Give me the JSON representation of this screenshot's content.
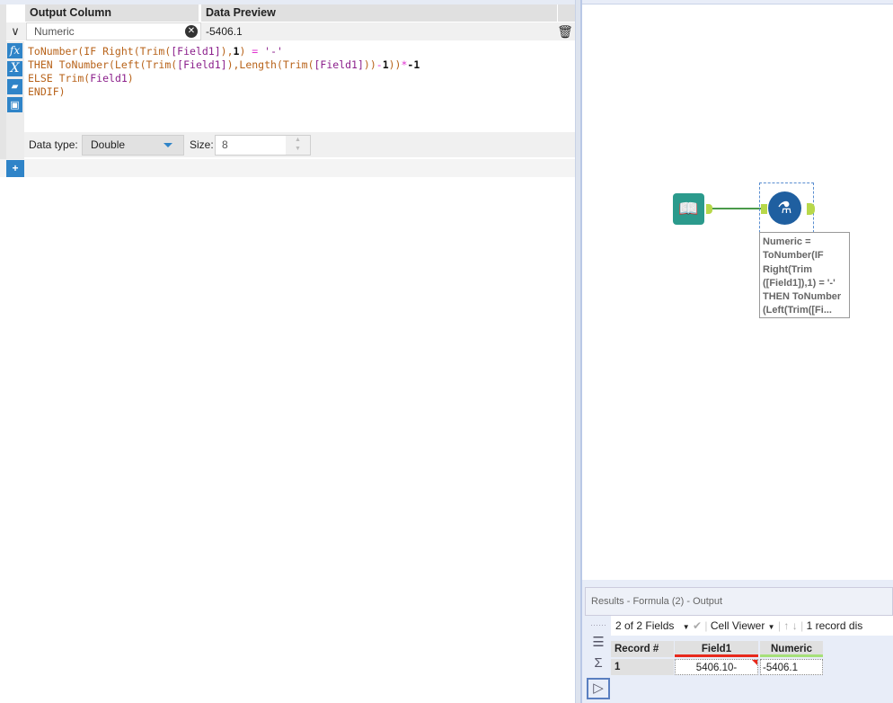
{
  "editor": {
    "headers": {
      "output_column": "Output Column",
      "data_preview": "Data Preview"
    },
    "row": {
      "name": "Numeric",
      "preview": "-5406.1"
    },
    "toolbar_icons": [
      "fx-icon",
      "variable-icon",
      "open-folder-icon",
      "save-icon"
    ],
    "formula_lines": [
      [
        [
          "ToNumber(IF Right(Trim(",
          "fn"
        ],
        [
          "[Field1]",
          "fld"
        ],
        [
          "),",
          "fn"
        ],
        [
          "1",
          "num"
        ],
        [
          ") ",
          "fn"
        ],
        [
          "= ",
          "op"
        ],
        [
          "'-'",
          "str"
        ]
      ],
      [
        [
          "THEN ToNumber(Left(Trim(",
          "fn"
        ],
        [
          "[Field1]",
          "fld"
        ],
        [
          "),Length(Trim(",
          "fn"
        ],
        [
          "[Field1]",
          "fld"
        ],
        [
          "))",
          "fn"
        ],
        [
          "-",
          "op"
        ],
        [
          "1",
          "num"
        ],
        [
          "))",
          "fn"
        ],
        [
          "*",
          "op"
        ],
        [
          "-1",
          "num"
        ]
      ],
      [
        [
          "ELSE Trim(",
          "fn"
        ],
        [
          "Field1",
          "fld"
        ],
        [
          ")",
          "fn"
        ]
      ],
      [
        [
          "ENDIF)",
          "fn"
        ]
      ]
    ],
    "data_type_label": "Data type:",
    "data_type": "Double",
    "size_label": "Size:",
    "size": "8"
  },
  "canvas": {
    "annotation": "Numeric =\nToNumber(IF\nRight(Trim\n([Field1]),1) = '-'\nTHEN ToNumber\n(Left(Trim([Fi..."
  },
  "results": {
    "title": "Results - Formula (2) - Output",
    "fields_selector": "2 of 2 Fields",
    "viewer": "Cell Viewer",
    "record_info": "1 record dis",
    "columns": [
      "Record #",
      "Field1",
      "Numeric"
    ],
    "rows": [
      [
        "1",
        "5406.10-",
        "-5406.1"
      ]
    ],
    "colors": {
      "field1_bar": "#e8291c",
      "numeric_bar": "#a6e07a"
    }
  }
}
